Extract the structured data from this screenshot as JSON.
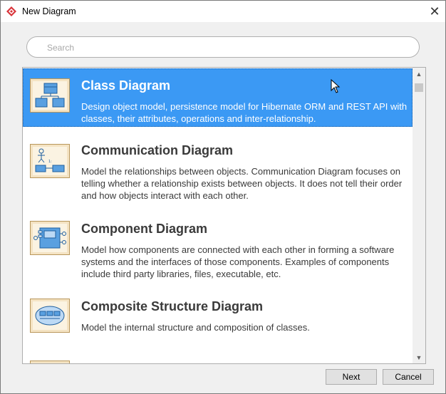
{
  "window": {
    "title": "New Diagram",
    "close_glyph": "✕",
    "accent_color": "#3b99f4"
  },
  "search": {
    "placeholder": "Search",
    "value": ""
  },
  "diagram_list": {
    "items": [
      {
        "title": "Class Diagram",
        "description": "Design object model, persistence model for Hibernate ORM and REST API with classes, their attributes, operations and inter-relationship.",
        "icon": "class-diagram-icon",
        "selected": true
      },
      {
        "title": "Communication Diagram",
        "description": "Model the relationships between objects. Communication Diagram focuses on telling whether a relationship exists between objects. It does not tell their order and how objects interact with each other.",
        "icon": "communication-diagram-icon",
        "selected": false
      },
      {
        "title": "Component Diagram",
        "description": "Model how components are connected with each other in forming a software systems and the interfaces of those components. Examples of components include third party libraries, files, executable, etc.",
        "icon": "component-diagram-icon",
        "selected": false
      },
      {
        "title": "Composite Structure Diagram",
        "description": "Model the internal structure and composition of classes.",
        "icon": "composite-structure-diagram-icon",
        "selected": false
      }
    ]
  },
  "scrollbar": {
    "up_glyph": "▲",
    "down_glyph": "▼"
  },
  "footer": {
    "next_label": "Next",
    "cancel_label": "Cancel"
  }
}
